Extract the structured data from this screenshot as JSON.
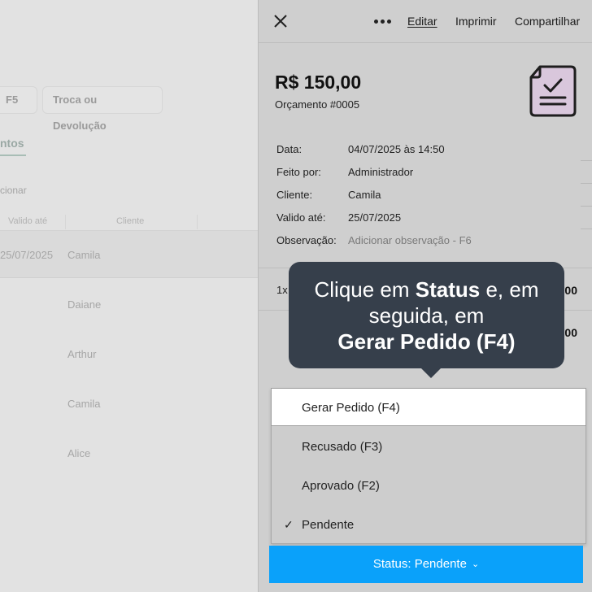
{
  "background": {
    "btn_f5": "F5",
    "btn_troca": "Troca ou Devolução",
    "tab_label": "ntos",
    "search_hint": "cionar",
    "col_valido": "Valido até",
    "col_cliente": "Cliente",
    "rows": [
      {
        "date": "25/07/2025",
        "client": "Camila"
      },
      {
        "date": "",
        "client": "Daiane"
      },
      {
        "date": "",
        "client": "Arthur"
      },
      {
        "date": "",
        "client": "Camila"
      },
      {
        "date": "",
        "client": "Alice"
      }
    ]
  },
  "panel": {
    "actions": {
      "edit": "Editar",
      "print": "Imprimir",
      "share": "Compartilhar"
    },
    "amount": "R$ 150,00",
    "budget_number": "Orçamento #0005",
    "details": [
      {
        "label": "Data:",
        "value": "04/07/2025 às 14:50"
      },
      {
        "label": "Feito por:",
        "value": "Administrador"
      },
      {
        "label": "Cliente:",
        "value": "Camila"
      },
      {
        "label": "Valido até:",
        "value": "25/07/2025"
      },
      {
        "label": "Observação:",
        "value": "Adicionar observação - F6"
      }
    ],
    "item_qty": "1x",
    "item_price_1": "00",
    "item_price_2": "00"
  },
  "tooltip": {
    "part1": "Clique em ",
    "part2": "Status",
    "part3": " e, em",
    "line2": "seguida, em",
    "line3": "Gerar Pedido (F4)"
  },
  "dropdown": {
    "options": [
      {
        "label": "Gerar Pedido (F4)"
      },
      {
        "label": "Recusado (F3)"
      },
      {
        "label": "Aprovado (F2)"
      },
      {
        "label": "Pendente",
        "check": "✓"
      }
    ]
  },
  "status_button": {
    "label": "Status: Pendente",
    "chevron": "⌄"
  },
  "colors": {
    "accent": "#0aa1fa",
    "tooltip_bg": "#363f4b",
    "doc_icon_fill": "#d9c7dc"
  }
}
